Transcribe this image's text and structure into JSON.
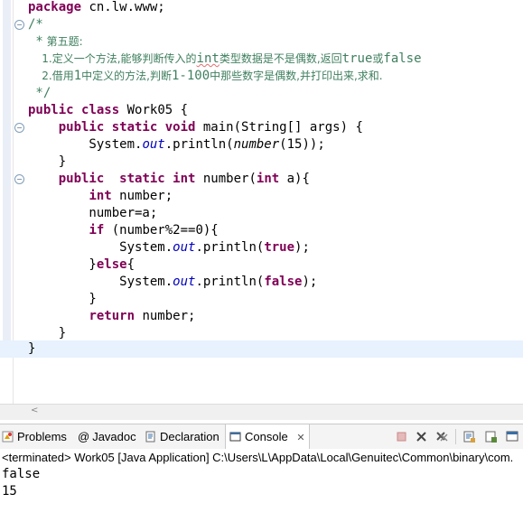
{
  "editor": {
    "lines": {
      "l1_kw": "package",
      "l1_rest": " cn.lw.www;",
      "l2": "/*",
      "l3_star": " *",
      "l3_text": " 第五题:",
      "l4_a": "    1.定义一个方法,能够判断传入的",
      "l4_b": "int",
      "l4_c": "类型数据是不是偶数,返回",
      "l4_d": "true",
      "l4_e": "或",
      "l4_f": "false",
      "l5_a": "    2.借用",
      "l5_b": "1",
      "l5_c": "中定义的方法,判断",
      "l5_d": "1-100",
      "l5_e": "中那些数字是偶数,并打印出来,求和.",
      "l6": " */",
      "l7_kw1": "public",
      "l7_kw2": "class",
      "l7_rest": " Work05 {",
      "l8_kw": "public static void",
      "l8_rest": " main(String[] args) {",
      "l9_a": "        System.",
      "l9_out": "out",
      "l9_b": ".println(",
      "l9_call": "number",
      "l9_c": "(15));",
      "l10": "    }",
      "l11_kw1": "public",
      "l11_kw2": "static int",
      "l11_rest": " number(",
      "l11_kw3": "int",
      "l11_rest2": " a){",
      "l12_kw": "int",
      "l12_rest": " number;",
      "l13": "        number=a;",
      "l14_kw": "if",
      "l14_rest": " (number%2==0){",
      "l15_a": "            System.",
      "l15_out": "out",
      "l15_b": ".println(",
      "l15_val": "true",
      "l15_c": ");",
      "l16_a": "        }",
      "l16_kw": "else",
      "l16_b": "{",
      "l17_a": "            System.",
      "l17_out": "out",
      "l17_b": ".println(",
      "l17_val": "false",
      "l17_c": ");",
      "l18": "        }",
      "l19_kw": "return",
      "l19_rest": " number;",
      "l20": "    }",
      "l21": "}"
    }
  },
  "tabs": {
    "problems": "Problems",
    "javadoc": "Javadoc",
    "declaration": "Declaration",
    "console": "Console",
    "console_close": "✕"
  },
  "console": {
    "terminated": "<terminated> Work05 [Java Application] C:\\Users\\L\\AppData\\Local\\Genuitec\\Common\\binary\\com.",
    "output": [
      "false",
      "15"
    ]
  },
  "colors": {
    "keyword": "#7f0055",
    "comment": "#3f7f5f",
    "field": "#0000c0",
    "current_line": "#e8f2fe"
  }
}
